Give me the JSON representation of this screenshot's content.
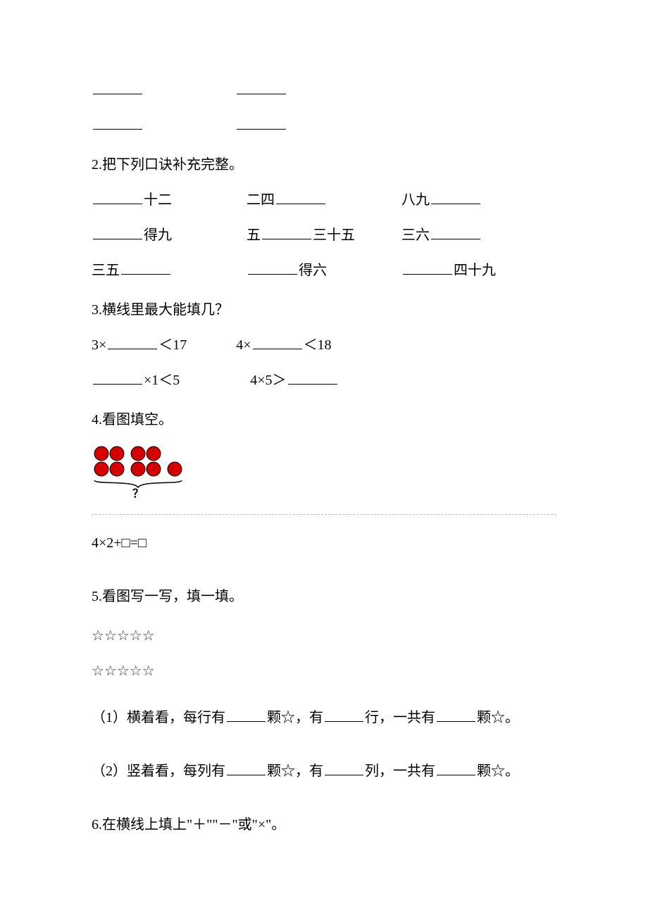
{
  "topBlanks": {
    "rows": 2
  },
  "q2": {
    "title": "2.把下列口诀补充完整。",
    "r1a_suffix": "十二",
    "r1b_prefix": "二四",
    "r1c_prefix": "八九",
    "r2a_suffix": "得九",
    "r2b_prefix": "五",
    "r2b_suffix": "三十五",
    "r2c_prefix": "三六",
    "r3a_prefix": "三五",
    "r3b_suffix": "得六",
    "r3c_suffix": "四十九"
  },
  "q3": {
    "title": "3.横线里最大能填几？",
    "a_prefix": "3×",
    "a_suffix": "＜17",
    "b_prefix": "4×",
    "b_suffix": "＜18",
    "c_suffix": "×1＜5",
    "d_prefix": "4×5＞"
  },
  "q4": {
    "title": "4.看图填空。",
    "question_mark": "？",
    "equation": "4×2+□=□"
  },
  "q5": {
    "title": "5.看图写一写，填一填。",
    "stars": "☆☆☆☆☆",
    "p1a": "（1）横着看，每行有",
    "p1b": "颗☆，有",
    "p1c": "行，一共有",
    "p1d": "颗☆。",
    "p2a": "（2）竖着看，每列有",
    "p2b": "颗☆，有",
    "p2c": "列，一共有",
    "p2d": "颗☆。"
  },
  "q6": {
    "title": "6.在横线上填上\"＋\"\"－\"或\"×\"。"
  }
}
